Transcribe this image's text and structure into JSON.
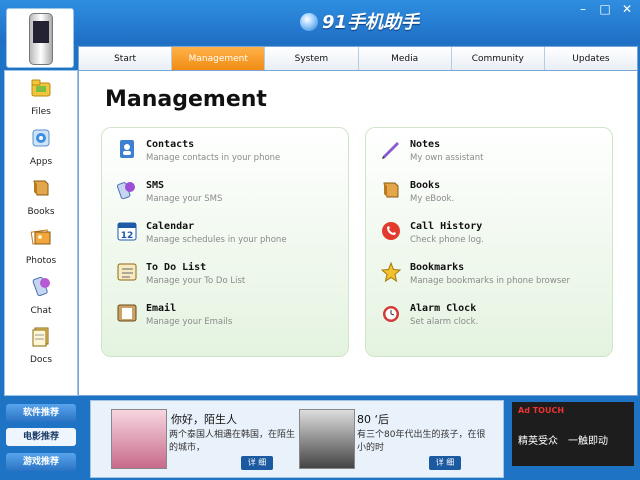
{
  "app": {
    "logo_text": "91手机助手"
  },
  "window": {
    "minimize": "–",
    "maximize": "□",
    "close": "✕"
  },
  "tabs": [
    {
      "label": "Start"
    },
    {
      "label": "Management"
    },
    {
      "label": "System"
    },
    {
      "label": "Media"
    },
    {
      "label": "Community"
    },
    {
      "label": "Updates"
    }
  ],
  "active_tab": "Management",
  "sidebar": {
    "items": [
      {
        "label": "Files",
        "icon": "folder-icon"
      },
      {
        "label": "Apps",
        "icon": "apps-icon"
      },
      {
        "label": "Books",
        "icon": "books-icon"
      },
      {
        "label": "Photos",
        "icon": "photos-icon"
      },
      {
        "label": "Chat",
        "icon": "chat-icon"
      },
      {
        "label": "Docs",
        "icon": "docs-icon"
      }
    ]
  },
  "main": {
    "title": "Management",
    "left_panel": [
      {
        "title": "Contacts",
        "desc": "Manage contacts in your phone",
        "icon": "contacts-icon"
      },
      {
        "title": "SMS",
        "desc": "Manage your SMS",
        "icon": "sms-icon"
      },
      {
        "title": "Calendar",
        "desc": "Manage schedules in your phone",
        "icon": "calendar-icon"
      },
      {
        "title": "To Do List",
        "desc": "Manage your To Do List",
        "icon": "todo-icon"
      },
      {
        "title": "Email",
        "desc": "Manage your Emails",
        "icon": "email-icon"
      }
    ],
    "right_panel": [
      {
        "title": "Notes",
        "desc": "My own assistant",
        "icon": "notes-icon"
      },
      {
        "title": "Books",
        "desc": "My eBook.",
        "icon": "book-icon"
      },
      {
        "title": "Call History",
        "desc": "Check phone log.",
        "icon": "call-history-icon"
      },
      {
        "title": "Bookmarks",
        "desc": "Manage bookmarks in phone browser",
        "icon": "bookmark-icon"
      },
      {
        "title": "Alarm Clock",
        "desc": "Set alarm clock.",
        "icon": "alarm-clock-icon"
      }
    ],
    "calendar_number": "12"
  },
  "bottom": {
    "left_buttons": [
      {
        "label": "软件推荐"
      },
      {
        "label": "电影推荐"
      },
      {
        "label": "游戏推荐"
      }
    ],
    "cards": [
      {
        "title": "你好，陌生人",
        "desc": "两个泰国人相遇在韩国，在陌生的城市，",
        "detail": "详 细"
      },
      {
        "title": "80 ‘后",
        "desc": "有三个80年代出生的孩子，在很小的时",
        "detail": "详 细"
      }
    ],
    "ad": {
      "brand": "Ad TOUCH",
      "slogan": "精英受众　一触即动"
    }
  },
  "colors": {
    "accent": "#f08a10",
    "frame": "#1f73c4"
  }
}
